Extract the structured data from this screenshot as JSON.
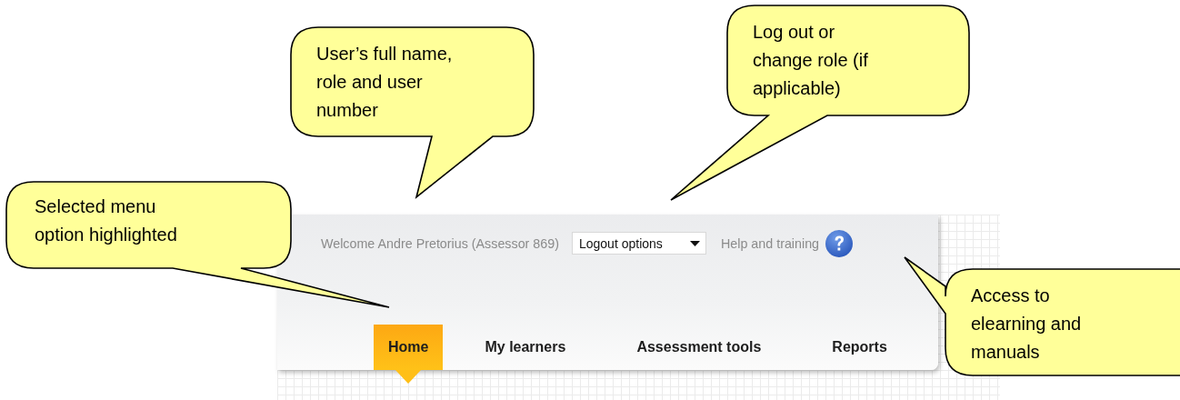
{
  "header": {
    "welcome": "Welcome Andre Pretorius (Assessor 869)",
    "logout_select": {
      "value": "Logout options"
    },
    "help_link": "Help and training"
  },
  "menu": [
    {
      "label": "Home",
      "selected": true
    },
    {
      "label": "My learners",
      "selected": false
    },
    {
      "label": "Assessment tools",
      "selected": false
    },
    {
      "label": "Reports",
      "selected": false
    }
  ],
  "callouts": [
    {
      "lines": [
        "User’s full name,",
        "role and user",
        "number"
      ]
    },
    {
      "lines": [
        "Log out or",
        "change role (if",
        "applicable)"
      ]
    },
    {
      "lines": [
        "Selected menu",
        "option highlighted"
      ]
    },
    {
      "lines": [
        "Access to",
        "elearning and",
        "manuals"
      ]
    }
  ]
}
